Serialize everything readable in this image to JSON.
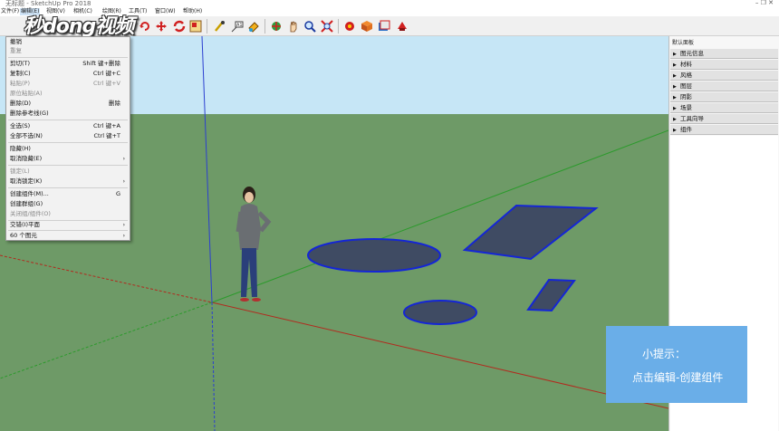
{
  "window": {
    "title": "无标题 - SketchUp Pro 2018",
    "controls": "– ❐ ✕"
  },
  "menubar": [
    {
      "label": "文件(F)"
    },
    {
      "label": "编辑(E)"
    },
    {
      "label": "视图(V)"
    },
    {
      "label": "相机(C)"
    },
    {
      "label": "绘图(R)"
    },
    {
      "label": "工具(T)"
    },
    {
      "label": "窗口(W)"
    },
    {
      "label": "帮助(H)"
    }
  ],
  "watermark": "秒dong视频",
  "edit_menu": {
    "items": [
      {
        "label": "撤销",
        "shortcut": "",
        "disabled": false
      },
      {
        "label": "重复",
        "shortcut": "",
        "disabled": true
      },
      {
        "label": "剪切(T)",
        "shortcut": "Shift 键+删除",
        "disabled": false
      },
      {
        "label": "复制(C)",
        "shortcut": "Ctrl 键+C",
        "disabled": false
      },
      {
        "label": "粘贴(P)",
        "shortcut": "Ctrl 键+V",
        "disabled": true
      },
      {
        "label": "原位粘贴(A)",
        "shortcut": "",
        "disabled": true
      },
      {
        "label": "删除(D)",
        "shortcut": "删除",
        "disabled": false
      },
      {
        "label": "删除参考线(G)",
        "shortcut": "",
        "disabled": false
      },
      {
        "label": "全选(S)",
        "shortcut": "Ctrl 键+A",
        "disabled": false
      },
      {
        "label": "全部不选(N)",
        "shortcut": "Ctrl 键+T",
        "disabled": false
      },
      {
        "label": "隐藏(H)",
        "shortcut": "",
        "disabled": false
      },
      {
        "label": "取消隐藏(E)",
        "shortcut": "",
        "disabled": false,
        "submenu": true
      },
      {
        "label": "锁定(L)",
        "shortcut": "",
        "disabled": true
      },
      {
        "label": "取消锁定(K)",
        "shortcut": "",
        "disabled": false,
        "submenu": true
      },
      {
        "label": "创建组件(M)...",
        "shortcut": "G",
        "disabled": false
      },
      {
        "label": "创建群组(G)",
        "shortcut": "",
        "disabled": false
      },
      {
        "label": "关闭组/组件(O)",
        "shortcut": "",
        "disabled": true
      },
      {
        "label": "交错(I)平面",
        "shortcut": "",
        "disabled": false,
        "submenu": true
      },
      {
        "label": "60 个图元",
        "shortcut": "",
        "disabled": false,
        "submenu": true
      }
    ]
  },
  "tray": {
    "title": "默认面板",
    "panels": [
      {
        "label": "图元信息"
      },
      {
        "label": "材料"
      },
      {
        "label": "风格"
      },
      {
        "label": "图层"
      },
      {
        "label": "阴影"
      },
      {
        "label": "场景"
      },
      {
        "label": "工具向导"
      },
      {
        "label": "组件"
      }
    ]
  },
  "tip": {
    "title": "小提示：",
    "text": "点击编辑-创建组件"
  },
  "colors": {
    "sky": "#c6e6f6",
    "ground": "#6e9a67",
    "shape_fill": "#3f4b63",
    "shape_stroke": "#1426d6",
    "axis_red": "#b22a1e",
    "axis_green": "#2c9a2c",
    "axis_blue": "#2b3fd0",
    "tip_bg": "#6aaee8"
  },
  "icons": [
    "select-arrow-icon",
    "eraser-icon",
    "paint-bucket-icon",
    "line-pencil-icon",
    "rectangle-icon",
    "circle-icon",
    "arc-icon",
    "move-icon",
    "rotate-icon",
    "push-pull-icon",
    "scale-icon",
    "offset-icon",
    "tape-measure-icon",
    "text-icon",
    "paint-icon",
    "orbit-icon",
    "pan-icon",
    "zoom-icon",
    "zoom-extents-icon",
    "warehouse-icon",
    "components-icon",
    "styles-icon",
    "extension-icon"
  ]
}
